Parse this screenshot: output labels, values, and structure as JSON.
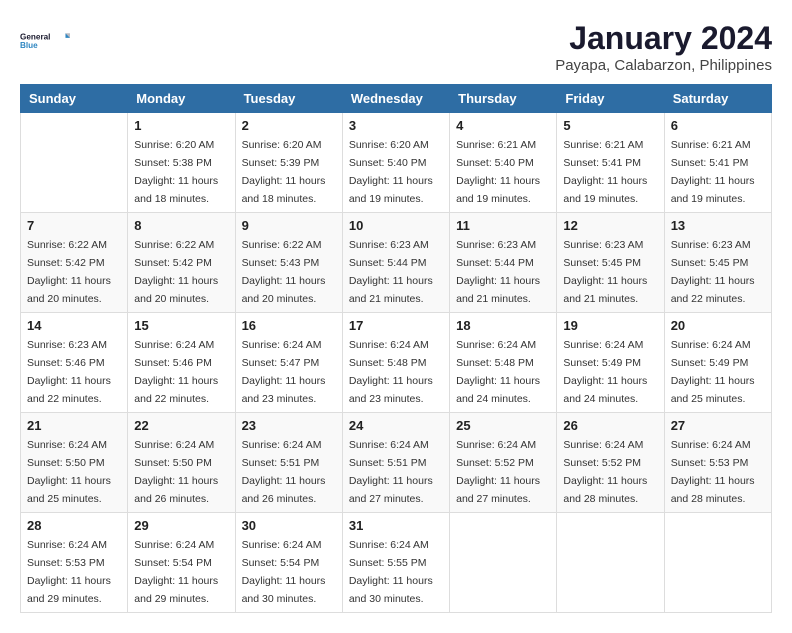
{
  "logo": {
    "line1": "General",
    "line2": "Blue"
  },
  "title": "January 2024",
  "subtitle": "Payapa, Calabarzon, Philippines",
  "weekdays": [
    "Sunday",
    "Monday",
    "Tuesday",
    "Wednesday",
    "Thursday",
    "Friday",
    "Saturday"
  ],
  "weeks": [
    [
      {
        "day": "",
        "sunrise": "",
        "sunset": "",
        "daylight": ""
      },
      {
        "day": "1",
        "sunrise": "Sunrise: 6:20 AM",
        "sunset": "Sunset: 5:38 PM",
        "daylight": "Daylight: 11 hours and 18 minutes."
      },
      {
        "day": "2",
        "sunrise": "Sunrise: 6:20 AM",
        "sunset": "Sunset: 5:39 PM",
        "daylight": "Daylight: 11 hours and 18 minutes."
      },
      {
        "day": "3",
        "sunrise": "Sunrise: 6:20 AM",
        "sunset": "Sunset: 5:40 PM",
        "daylight": "Daylight: 11 hours and 19 minutes."
      },
      {
        "day": "4",
        "sunrise": "Sunrise: 6:21 AM",
        "sunset": "Sunset: 5:40 PM",
        "daylight": "Daylight: 11 hours and 19 minutes."
      },
      {
        "day": "5",
        "sunrise": "Sunrise: 6:21 AM",
        "sunset": "Sunset: 5:41 PM",
        "daylight": "Daylight: 11 hours and 19 minutes."
      },
      {
        "day": "6",
        "sunrise": "Sunrise: 6:21 AM",
        "sunset": "Sunset: 5:41 PM",
        "daylight": "Daylight: 11 hours and 19 minutes."
      }
    ],
    [
      {
        "day": "7",
        "sunrise": "Sunrise: 6:22 AM",
        "sunset": "Sunset: 5:42 PM",
        "daylight": "Daylight: 11 hours and 20 minutes."
      },
      {
        "day": "8",
        "sunrise": "Sunrise: 6:22 AM",
        "sunset": "Sunset: 5:42 PM",
        "daylight": "Daylight: 11 hours and 20 minutes."
      },
      {
        "day": "9",
        "sunrise": "Sunrise: 6:22 AM",
        "sunset": "Sunset: 5:43 PM",
        "daylight": "Daylight: 11 hours and 20 minutes."
      },
      {
        "day": "10",
        "sunrise": "Sunrise: 6:23 AM",
        "sunset": "Sunset: 5:44 PM",
        "daylight": "Daylight: 11 hours and 21 minutes."
      },
      {
        "day": "11",
        "sunrise": "Sunrise: 6:23 AM",
        "sunset": "Sunset: 5:44 PM",
        "daylight": "Daylight: 11 hours and 21 minutes."
      },
      {
        "day": "12",
        "sunrise": "Sunrise: 6:23 AM",
        "sunset": "Sunset: 5:45 PM",
        "daylight": "Daylight: 11 hours and 21 minutes."
      },
      {
        "day": "13",
        "sunrise": "Sunrise: 6:23 AM",
        "sunset": "Sunset: 5:45 PM",
        "daylight": "Daylight: 11 hours and 22 minutes."
      }
    ],
    [
      {
        "day": "14",
        "sunrise": "Sunrise: 6:23 AM",
        "sunset": "Sunset: 5:46 PM",
        "daylight": "Daylight: 11 hours and 22 minutes."
      },
      {
        "day": "15",
        "sunrise": "Sunrise: 6:24 AM",
        "sunset": "Sunset: 5:46 PM",
        "daylight": "Daylight: 11 hours and 22 minutes."
      },
      {
        "day": "16",
        "sunrise": "Sunrise: 6:24 AM",
        "sunset": "Sunset: 5:47 PM",
        "daylight": "Daylight: 11 hours and 23 minutes."
      },
      {
        "day": "17",
        "sunrise": "Sunrise: 6:24 AM",
        "sunset": "Sunset: 5:48 PM",
        "daylight": "Daylight: 11 hours and 23 minutes."
      },
      {
        "day": "18",
        "sunrise": "Sunrise: 6:24 AM",
        "sunset": "Sunset: 5:48 PM",
        "daylight": "Daylight: 11 hours and 24 minutes."
      },
      {
        "day": "19",
        "sunrise": "Sunrise: 6:24 AM",
        "sunset": "Sunset: 5:49 PM",
        "daylight": "Daylight: 11 hours and 24 minutes."
      },
      {
        "day": "20",
        "sunrise": "Sunrise: 6:24 AM",
        "sunset": "Sunset: 5:49 PM",
        "daylight": "Daylight: 11 hours and 25 minutes."
      }
    ],
    [
      {
        "day": "21",
        "sunrise": "Sunrise: 6:24 AM",
        "sunset": "Sunset: 5:50 PM",
        "daylight": "Daylight: 11 hours and 25 minutes."
      },
      {
        "day": "22",
        "sunrise": "Sunrise: 6:24 AM",
        "sunset": "Sunset: 5:50 PM",
        "daylight": "Daylight: 11 hours and 26 minutes."
      },
      {
        "day": "23",
        "sunrise": "Sunrise: 6:24 AM",
        "sunset": "Sunset: 5:51 PM",
        "daylight": "Daylight: 11 hours and 26 minutes."
      },
      {
        "day": "24",
        "sunrise": "Sunrise: 6:24 AM",
        "sunset": "Sunset: 5:51 PM",
        "daylight": "Daylight: 11 hours and 27 minutes."
      },
      {
        "day": "25",
        "sunrise": "Sunrise: 6:24 AM",
        "sunset": "Sunset: 5:52 PM",
        "daylight": "Daylight: 11 hours and 27 minutes."
      },
      {
        "day": "26",
        "sunrise": "Sunrise: 6:24 AM",
        "sunset": "Sunset: 5:52 PM",
        "daylight": "Daylight: 11 hours and 28 minutes."
      },
      {
        "day": "27",
        "sunrise": "Sunrise: 6:24 AM",
        "sunset": "Sunset: 5:53 PM",
        "daylight": "Daylight: 11 hours and 28 minutes."
      }
    ],
    [
      {
        "day": "28",
        "sunrise": "Sunrise: 6:24 AM",
        "sunset": "Sunset: 5:53 PM",
        "daylight": "Daylight: 11 hours and 29 minutes."
      },
      {
        "day": "29",
        "sunrise": "Sunrise: 6:24 AM",
        "sunset": "Sunset: 5:54 PM",
        "daylight": "Daylight: 11 hours and 29 minutes."
      },
      {
        "day": "30",
        "sunrise": "Sunrise: 6:24 AM",
        "sunset": "Sunset: 5:54 PM",
        "daylight": "Daylight: 11 hours and 30 minutes."
      },
      {
        "day": "31",
        "sunrise": "Sunrise: 6:24 AM",
        "sunset": "Sunset: 5:55 PM",
        "daylight": "Daylight: 11 hours and 30 minutes."
      },
      {
        "day": "",
        "sunrise": "",
        "sunset": "",
        "daylight": ""
      },
      {
        "day": "",
        "sunrise": "",
        "sunset": "",
        "daylight": ""
      },
      {
        "day": "",
        "sunrise": "",
        "sunset": "",
        "daylight": ""
      }
    ]
  ]
}
